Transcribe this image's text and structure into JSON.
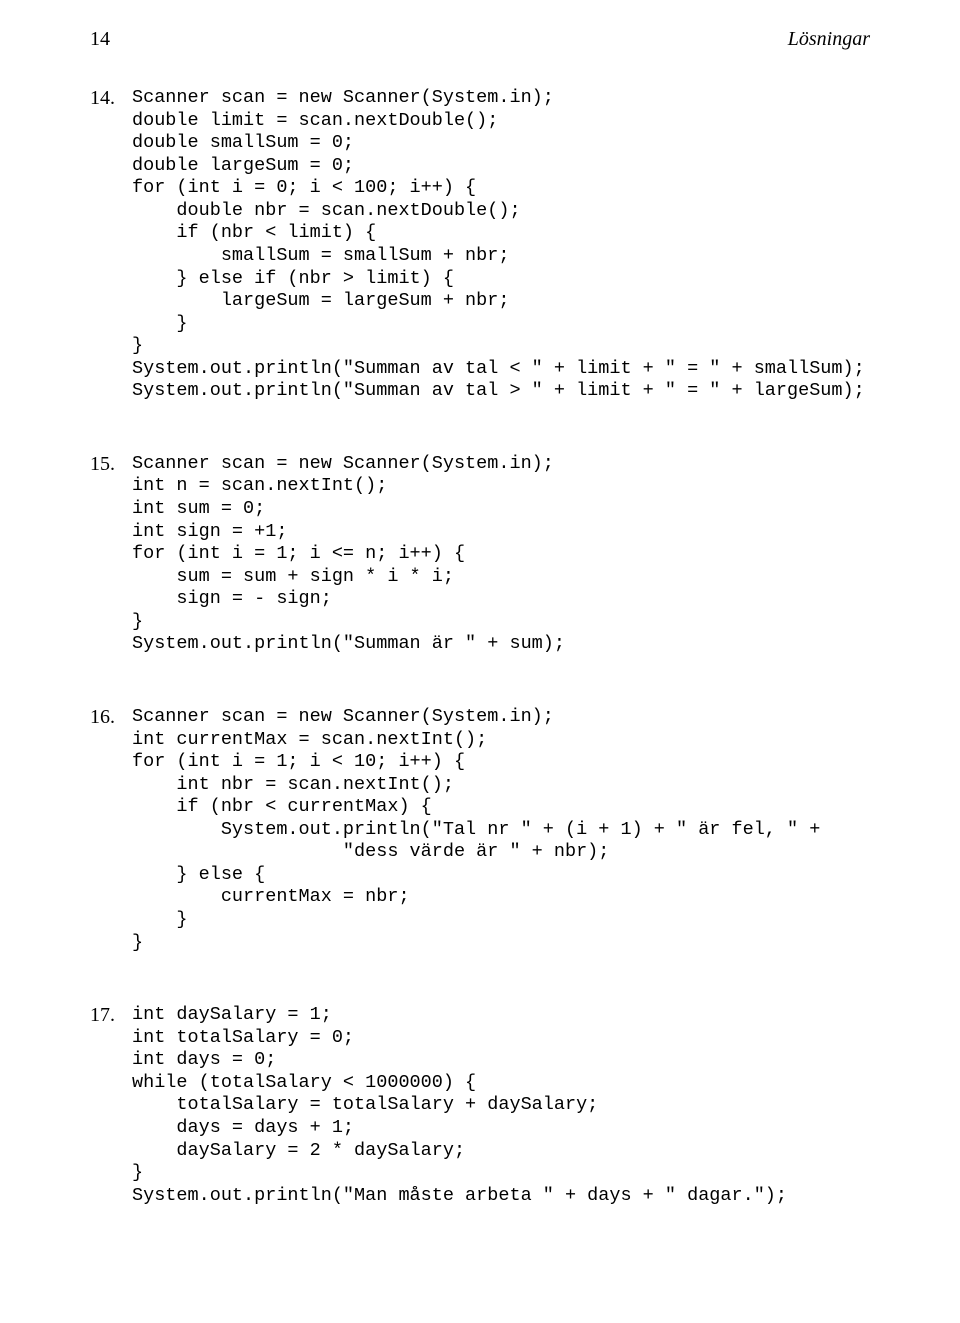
{
  "header": {
    "page_number": "14",
    "title": "Lösningar"
  },
  "solutions": [
    {
      "number": "14.",
      "code": "Scanner scan = new Scanner(System.in);\ndouble limit = scan.nextDouble();\ndouble smallSum = 0;\ndouble largeSum = 0;\nfor (int i = 0; i < 100; i++) {\n    double nbr = scan.nextDouble();\n    if (nbr < limit) {\n        smallSum = smallSum + nbr;\n    } else if (nbr > limit) {\n        largeSum = largeSum + nbr;\n    }\n}\nSystem.out.println(\"Summan av tal < \" + limit + \" = \" + smallSum);\nSystem.out.println(\"Summan av tal > \" + limit + \" = \" + largeSum);"
    },
    {
      "number": "15.",
      "code": "Scanner scan = new Scanner(System.in);\nint n = scan.nextInt();\nint sum = 0;\nint sign = +1;\nfor (int i = 1; i <= n; i++) {\n    sum = sum + sign * i * i;\n    sign = - sign;\n}\nSystem.out.println(\"Summan är \" + sum);"
    },
    {
      "number": "16.",
      "code": "Scanner scan = new Scanner(System.in);\nint currentMax = scan.nextInt();\nfor (int i = 1; i < 10; i++) {\n    int nbr = scan.nextInt();\n    if (nbr < currentMax) {\n        System.out.println(\"Tal nr \" + (i + 1) + \" är fel, \" +\n                   \"dess värde är \" + nbr);\n    } else {\n        currentMax = nbr;\n    }\n}"
    },
    {
      "number": "17.",
      "code": "int daySalary = 1;\nint totalSalary = 0;\nint days = 0;\nwhile (totalSalary < 1000000) {\n    totalSalary = totalSalary + daySalary;\n    days = days + 1;\n    daySalary = 2 * daySalary;\n}\nSystem.out.println(\"Man måste arbeta \" + days + \" dagar.\");"
    }
  ]
}
